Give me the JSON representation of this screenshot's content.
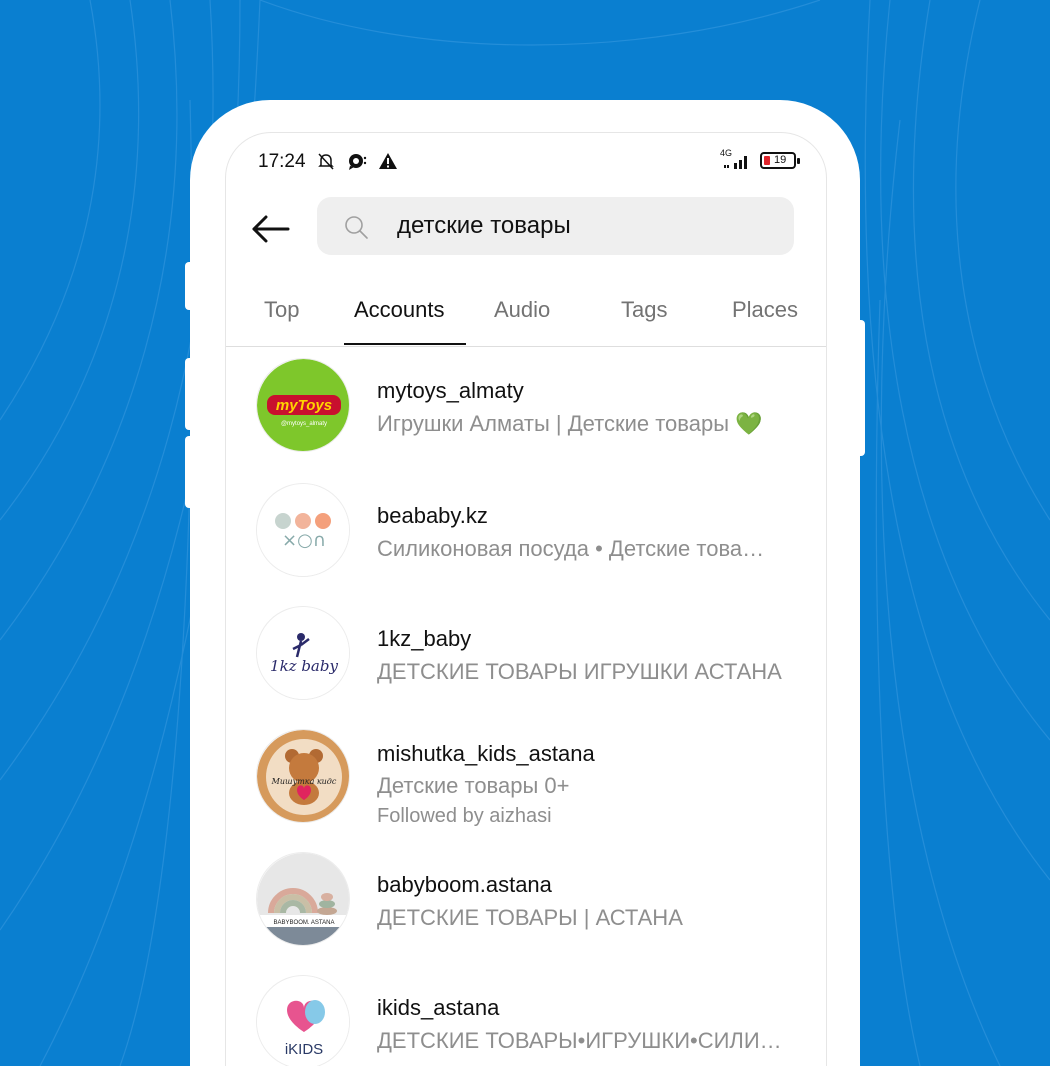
{
  "status": {
    "time": "17:24",
    "network": "4G",
    "battery": "19",
    "icons": [
      "bell-off-icon",
      "chat-bubble-icon",
      "warning-icon",
      "signal-icon",
      "battery-icon"
    ]
  },
  "search": {
    "query": "детские товары",
    "icons": [
      "back-arrow-icon",
      "search-icon"
    ]
  },
  "tabs": [
    {
      "label": "Top"
    },
    {
      "label": "Accounts",
      "active": true
    },
    {
      "label": "Audio"
    },
    {
      "label": "Tags"
    },
    {
      "label": "Places"
    }
  ],
  "results": [
    {
      "username": "mytoys_almaty",
      "description": "Игрушки Алматы | Детские товары",
      "badge": "💚",
      "avatar_text": "myToys",
      "avatar_subtext": "@mytoys_almaty"
    },
    {
      "username": "beababy.kz",
      "description": "Силиконовая посуда •  Детские това…",
      "avatar_text": "×○∩"
    },
    {
      "username": "1kz_baby",
      "description": "ДЕТСКИЕ ТОВАРЫ ИГРУШКИ АСТАНА",
      "avatar_text": "1kz baby"
    },
    {
      "username": "mishutka_kids_astana",
      "description": "Детские товары 0+",
      "followed_by": "Followed by aizhasi",
      "avatar_text": "Мишутка кидс"
    },
    {
      "username": "babyboom.astana",
      "description": "ДЕТСКИЕ ТОВАРЫ | АСТАНА",
      "avatar_text": "BABYBOOM. ASTANA"
    },
    {
      "username": "ikids_astana",
      "description": "ДЕТСКИЕ ТОВАРЫ•ИГРУШКИ•СИЛИ…",
      "avatar_text": "iKIDS"
    }
  ],
  "colors": {
    "background": "#0a7fd0",
    "primary_text": "#111111",
    "secondary_text": "#8e8e8e",
    "search_bg": "#efefef",
    "mytoys_green": "#7ec72b"
  }
}
